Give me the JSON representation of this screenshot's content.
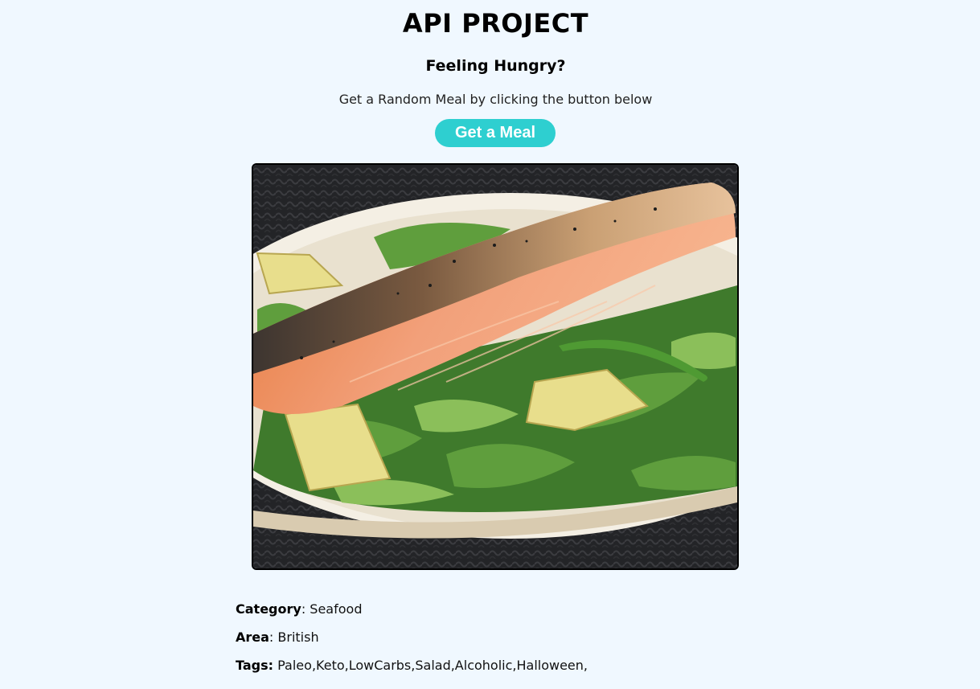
{
  "header": {
    "title": "API PROJECT",
    "subtitle": "Feeling Hungry?",
    "instruction": "Get a Random Meal by clicking the button below"
  },
  "button": {
    "label": "Get a Meal",
    "color": "#2ecfd0"
  },
  "meal": {
    "category_label": "Category",
    "category": "Seafood",
    "area_label": "Area",
    "area": "British",
    "tags_label": "Tags:",
    "tags": "Paleo,Keto,LowCarbs,Salad,Alcoholic,Halloween,"
  }
}
